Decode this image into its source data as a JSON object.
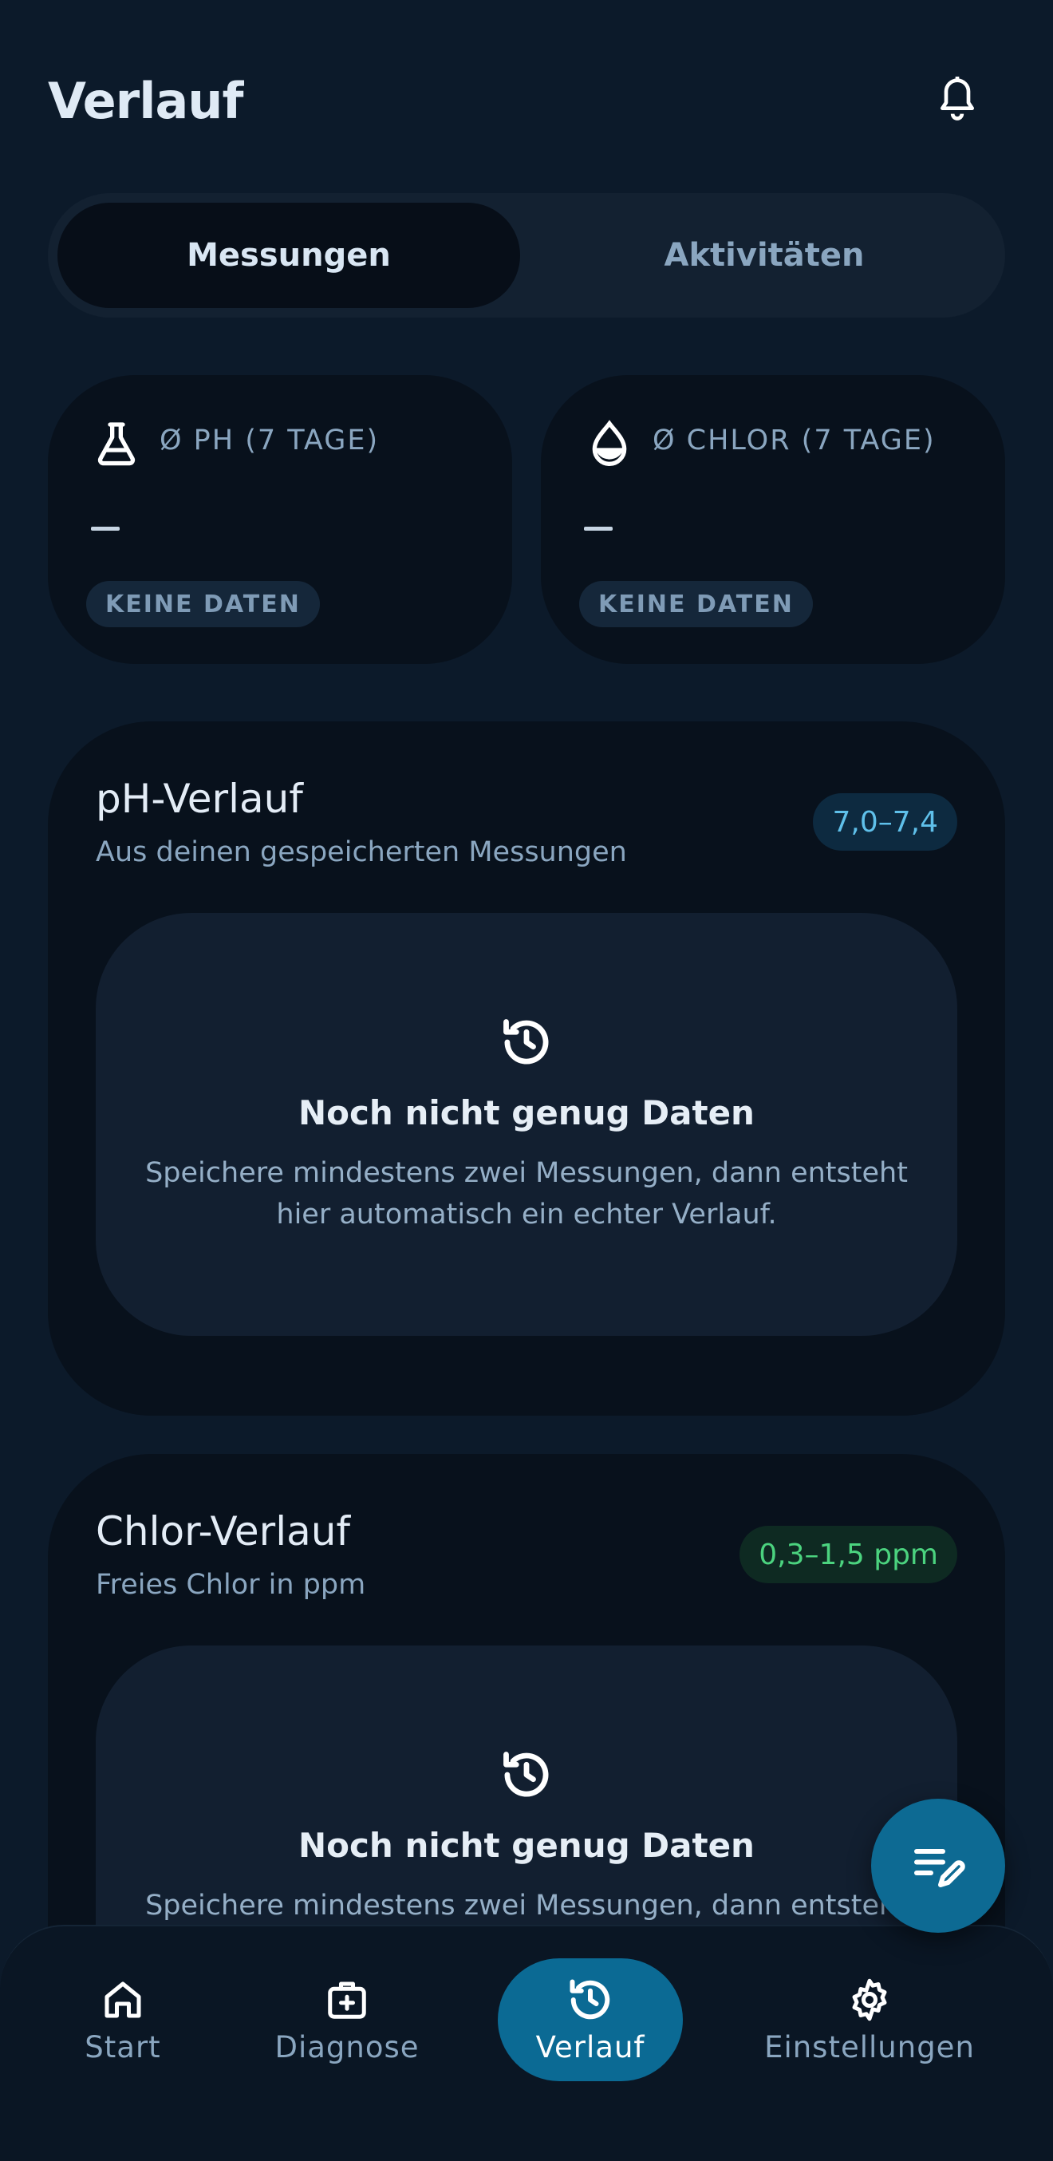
{
  "header": {
    "title": "Verlauf",
    "bell_icon": "bell-icon"
  },
  "segmented": {
    "tabs": [
      {
        "label": "Messungen",
        "active": true
      },
      {
        "label": "Aktivitäten",
        "active": false
      }
    ]
  },
  "stats": [
    {
      "icon": "flask-icon",
      "label": "Ø PH (7 TAGE)",
      "value": "–",
      "badge": "KEINE DATEN"
    },
    {
      "icon": "droplet-icon",
      "label": "Ø CHLOR (7 TAGE)",
      "value": "–",
      "badge": "KEINE DATEN"
    }
  ],
  "cards": [
    {
      "title": "pH-Verlauf",
      "subtitle": "Aus deinen gespeicherten Messungen",
      "range": "7,0–7,4",
      "range_color": "#5fc0ea",
      "empty_title": "Noch nicht genug Daten",
      "empty_text": "Speichere mindestens zwei Messungen, dann entsteht hier automatisch ein echter Verlauf."
    },
    {
      "title": "Chlor-Verlauf",
      "subtitle": "Freies Chlor in ppm",
      "range": "0,3–1,5 ppm",
      "range_color": "#4bd37f",
      "empty_title": "Noch nicht genug Daten",
      "empty_text": "Speichere mindestens zwei Messungen, dann entsteht hier automatisch ein echter Verlauf."
    }
  ],
  "fab": {
    "icon": "edit-note-icon"
  },
  "nav": {
    "items": [
      {
        "label": "Start",
        "icon": "home-icon"
      },
      {
        "label": "Diagnose",
        "icon": "medical-kit-icon"
      },
      {
        "label": "Verlauf",
        "icon": "history-icon",
        "active": true
      },
      {
        "label": "Einstellungen",
        "icon": "gear-icon"
      }
    ]
  },
  "colors": {
    "background": "#0c1a2a",
    "card": "#08111c",
    "accent": "#0b6a94"
  }
}
